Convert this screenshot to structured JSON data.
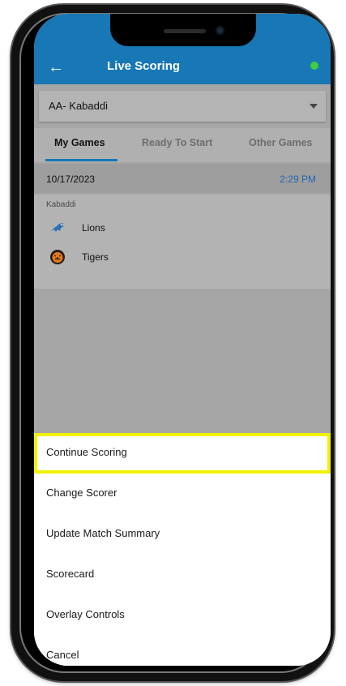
{
  "header": {
    "title": "Live Scoring"
  },
  "league_select": {
    "value": "AA- Kabaddi"
  },
  "tabs": [
    {
      "label": "My Games",
      "active": true
    },
    {
      "label": "Ready To Start",
      "active": false
    },
    {
      "label": "Other Games",
      "active": false
    }
  ],
  "game": {
    "date": "10/17/2023",
    "time": "2:29 PM",
    "sport": "Kabaddi",
    "teams": [
      {
        "name": "Lions",
        "logo": "lion-logo-icon"
      },
      {
        "name": "Tigers",
        "logo": "tiger-logo-icon"
      }
    ]
  },
  "action_sheet": {
    "items": [
      {
        "label": "Continue Scoring",
        "highlighted": true
      },
      {
        "label": "Change Scorer"
      },
      {
        "label": "Update Match Summary"
      },
      {
        "label": "Scorecard"
      },
      {
        "label": "Overlay Controls"
      },
      {
        "label": "Cancel"
      }
    ]
  },
  "colors": {
    "header": "#1877b5",
    "highlight": "#f1f100",
    "status": "#3fcf3f",
    "time": "#2368b2"
  }
}
